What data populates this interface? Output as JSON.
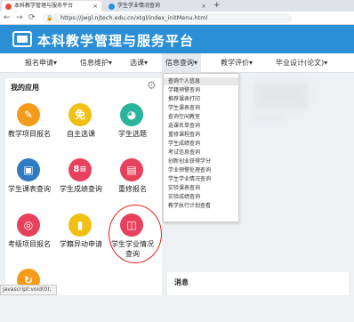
{
  "browser": {
    "tabs": [
      {
        "label": "本科教学管理与服务平台",
        "active": true
      },
      {
        "label": "学生学业情况查询",
        "active": false
      }
    ],
    "new_tab": "+",
    "url": "https://jwgl.njtech.edu.cn/xtgl/index_initMenu.html",
    "back": "←",
    "forward": "→",
    "reload": "⟳"
  },
  "site": {
    "title": "本科教学管理与服务平台"
  },
  "menu": [
    "报名申请",
    "信息维护",
    "选课",
    "信息查询",
    "教学评价",
    "毕业设计(论文)"
  ],
  "my_apps": {
    "title": "我的应用",
    "apps": [
      {
        "label": "教学项目报名",
        "glyph": "✎",
        "color": "#f59b1b"
      },
      {
        "label": "自主选课",
        "glyph": "免",
        "color": "#f2c014"
      },
      {
        "label": "学生选题",
        "glyph": "◕",
        "color": "#29b59c"
      },
      {
        "label": "学生课表查询",
        "glyph": "▣",
        "color": "#2e7bc4"
      },
      {
        "label": "学生成绩查询",
        "glyph": "8≡",
        "color": "#e8415d"
      },
      {
        "label": "重修报名",
        "glyph": "▤",
        "color": "#e8415d"
      },
      {
        "label": "考级项目报名",
        "glyph": "◎",
        "color": "#e8415d"
      },
      {
        "label": "学籍异动申请",
        "glyph": "▮",
        "color": "#f2c014"
      },
      {
        "label": "学生学业情况查询",
        "glyph": "◫",
        "color": "#e8415d"
      },
      {
        "label": "",
        "glyph": "↻",
        "color": "#f59b1b"
      }
    ]
  },
  "dropdown": [
    "查询个人信息",
    "学籍预警查询",
    "推荐课表打印",
    "学生课表查询",
    "查询空闲教室",
    "选课名单查询",
    "重修课程查询",
    "学生成绩查询",
    "考试信息查询",
    "创新创业获得学分",
    "学业预警处理查询",
    "学生学业情况查询",
    "实验课表查询",
    "实验成绩查询",
    "教学执行计划查看"
  ],
  "bottom_panel": {
    "title": "消息"
  },
  "status": "javascript:void(0);",
  "colors": {
    "header": "#2b8fd5",
    "highlight": "#e2231a"
  }
}
